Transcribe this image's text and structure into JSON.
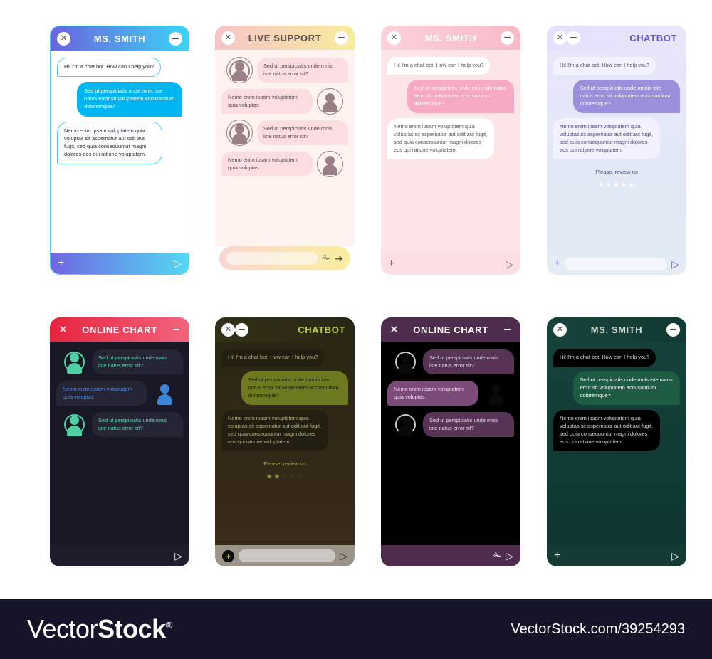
{
  "messages": {
    "greeting": "Hi! I'm a chat bot. How can I help you?",
    "question_mnis": "Sed ut perspiciatis unde mnis iste natus error sit voluptatem accusantium doloremque?",
    "question_omnis": "Sed ut perspiciatis unde omnis iste natus error sit voluptatem accusantium doloremque?",
    "answer_long": "Nemo enim ipsam voluptatem quia voluptas sit aspernatur aut odit aut fugit, sed quia consequuntur magni dolores eos qui ratione voluptatem.",
    "short_question": "Sed ut perspiciatis unde mnis iste natus error sit?",
    "short_answer": "Nemo enim ipsam voluptatem quia voluptas",
    "review_label": "Please, review us"
  },
  "icons": {
    "close": "✕",
    "send": "▷",
    "send_solid": "➔",
    "plus": "+",
    "clip": "✁",
    "star": "★"
  },
  "cards": [
    {
      "id": "card-blue-ms-smith",
      "title": "MS. SMITH",
      "theme": "blue-gradient",
      "header_layout": "close-title-minimize",
      "bubbles": [
        "greeting",
        "question_mnis",
        "answer_long"
      ],
      "footer": {
        "plus": true,
        "send": true,
        "clip": false,
        "input": false
      },
      "review": false,
      "colors": {
        "header_from": "#6b63e0",
        "header_to": "#3dd3f5",
        "body": "#ffffff",
        "border": "#3fd0f0",
        "bubble_in_bg": "#ffffff",
        "bubble_in_text": "#2b2b3a",
        "bubble_out_bg": "#00b6f0",
        "bubble_out_text": "#ffffff",
        "footer_from": "#6f66e2",
        "footer_to": "#53d8f2",
        "icon": "#ffffff",
        "title": "#ffffff"
      }
    },
    {
      "id": "card-live-support",
      "title": "LIVE SUPPORT",
      "theme": "pink-yellow-gradient",
      "header_layout": "close-title-minimize",
      "bubbles": [
        "short_question",
        "short_answer",
        "short_question",
        "short_answer"
      ],
      "with_avatars": true,
      "footer": {
        "plus": false,
        "send": true,
        "clip": true,
        "input": true
      },
      "review": false,
      "colors": {
        "header_from": "#f6c4c9",
        "header_to": "#f7ec9b",
        "body": "#fdf2ee",
        "border": "transparent",
        "bubble_in_bg": "#fbdde1",
        "bubble_in_text": "#55454c",
        "bubble_out_bg": "#fbdde1",
        "bubble_out_text": "#55454c",
        "footer_from": "#f8d7d2",
        "footer_to": "#f8ee9e",
        "icon": "#6b5050",
        "title": "#5b4b4b",
        "avatar": "#9b7f86"
      }
    },
    {
      "id": "card-pink-ms-smith",
      "title": "MS. SMITH",
      "theme": "pink",
      "header_layout": "close-title-minimize",
      "bubbles": [
        "greeting",
        "question_mnis",
        "answer_long"
      ],
      "footer": {
        "plus": true,
        "send": true,
        "clip": false,
        "input": false
      },
      "review": false,
      "colors": {
        "header_from": "#fbd2da",
        "header_to": "#f8b9c8",
        "body": "#fce4e6",
        "border": "transparent",
        "bubble_in_bg": "#ffffff",
        "bubble_in_text": "#56505a",
        "bubble_out_bg": "#f5a9c2",
        "bubble_out_text": "#ffffff",
        "footer_from": "#fbdfe2",
        "footer_to": "#fbdfe2",
        "icon": "#6a5a62",
        "title": "#ffffff"
      }
    },
    {
      "id": "card-chatbot-lavender",
      "title": "CHATBOT",
      "theme": "lavender-blue",
      "header_layout": "close-minimize-title",
      "bubbles": [
        "greeting",
        "question_omnis",
        "answer_long"
      ],
      "footer": {
        "plus": true,
        "send": true,
        "clip": false,
        "input": true
      },
      "review": true,
      "stars_filled": 0,
      "colors": {
        "header_from": "#e2e1fb",
        "header_to": "#e7e6fb",
        "body_from": "#e7e6fb",
        "body_to": "#dfeaf2",
        "border": "transparent",
        "bubble_in_bg": "#f2f1fd",
        "bubble_in_text": "#4b4a73",
        "bubble_out_bg": "#9b8fdb",
        "bubble_out_text": "#ffffff",
        "footer": "#e4ecf3",
        "icon": "#6355c8",
        "title": "#6355c8",
        "star": "#ffffff",
        "review_text": "#4b4a73"
      }
    },
    {
      "id": "card-online-chart-red",
      "title": "ONLINE CHART",
      "theme": "dark-red",
      "header_layout": "close-title-minimize",
      "header_flat_icons": true,
      "bubbles": [
        "short_question",
        "short_answer",
        "short_question"
      ],
      "with_avatars": true,
      "footer": {
        "plus": false,
        "send": true,
        "clip": false,
        "input": false
      },
      "review": false,
      "colors": {
        "header_from": "#e8243f",
        "header_to": "#f2647e",
        "body": "#181826",
        "border": "transparent",
        "bubble_in_bg": "#252536",
        "bubble_in_text": "#63d6b4",
        "bubble_out_bg": "#252536",
        "bubble_out_text": "#5f8bd8",
        "footer": "#1d1d2c",
        "icon": "#ffffff",
        "title": "#ffffff",
        "avatar_agent": "#4fd1a5",
        "avatar_user": "#3a85d8"
      }
    },
    {
      "id": "card-chatbot-olive",
      "title": "CHATBOT",
      "theme": "dark-olive",
      "header_layout": "close-minimize-title",
      "bubbles": [
        "greeting",
        "question_omnis",
        "answer_long"
      ],
      "footer": {
        "plus": true,
        "send": true,
        "clip": false,
        "input": true
      },
      "review": true,
      "stars_filled": 2,
      "colors": {
        "header_from": "#333018",
        "header_to": "#2a2614",
        "body_from": "#2b2714",
        "body_to": "#3a2a1c",
        "border": "transparent",
        "bubble_in_bg": "#231f10",
        "bubble_in_text": "#b9b484",
        "bubble_out_bg": "#6f7a20",
        "bubble_out_text": "#1b1b0c",
        "footer": "#9a9489",
        "icon_plus_bg": "#0d0d07",
        "icon": "#1b1b0c",
        "title": "#c3cf39",
        "star_on": "#8a9327",
        "star_off": "#3a3519",
        "review_text": "#a8ae4f",
        "input_bg": "#cbc8c3"
      }
    },
    {
      "id": "card-online-chart-purple",
      "title": "ONLINE CHART",
      "theme": "dark-purple",
      "header_layout": "close-title-minimize",
      "header_flat_icons": true,
      "bubbles": [
        "short_question",
        "short_answer",
        "short_question"
      ],
      "with_avatars": true,
      "footer": {
        "plus": false,
        "send": true,
        "clip": true,
        "input": false
      },
      "review": false,
      "colors": {
        "header": "#4e2c4d",
        "body": "#000000",
        "border": "transparent",
        "bubble_in_bg": "#573456",
        "bubble_in_text": "#e8dce7",
        "bubble_out_bg": "#7b4a78",
        "bubble_out_text": "#f0e7ef",
        "footer": "#4e2c4d",
        "icon": "#ffffff",
        "title": "#ffffff",
        "avatar_face": "#0a0a0a",
        "avatar_ring": "#c9c9c9"
      }
    },
    {
      "id": "card-green-ms-smith",
      "title": "MS. SMITH",
      "theme": "dark-teal",
      "header_layout": "close-title-minimize",
      "bubbles": [
        "greeting",
        "question_mnis",
        "answer_long"
      ],
      "footer": {
        "plus": true,
        "send": true,
        "clip": false,
        "input": false
      },
      "review": false,
      "colors": {
        "header_from": "#17433c",
        "header_to": "#133a34",
        "body_from": "#14423a",
        "body_to": "#0f3630",
        "border": "transparent",
        "bubble_in_bg": "#000000",
        "bubble_in_text": "#d6ded8",
        "bubble_out_bg": "#1d5c43",
        "bubble_out_text": "#ffffff",
        "footer": "#143c35",
        "icon": "#ffffff",
        "title": "#cfd9d3"
      }
    }
  ],
  "watermark": {
    "logo_prefix": "Vector",
    "logo_suffix": "Stock",
    "logo_mark": "®",
    "url": "VectorStock.com/39254293"
  }
}
